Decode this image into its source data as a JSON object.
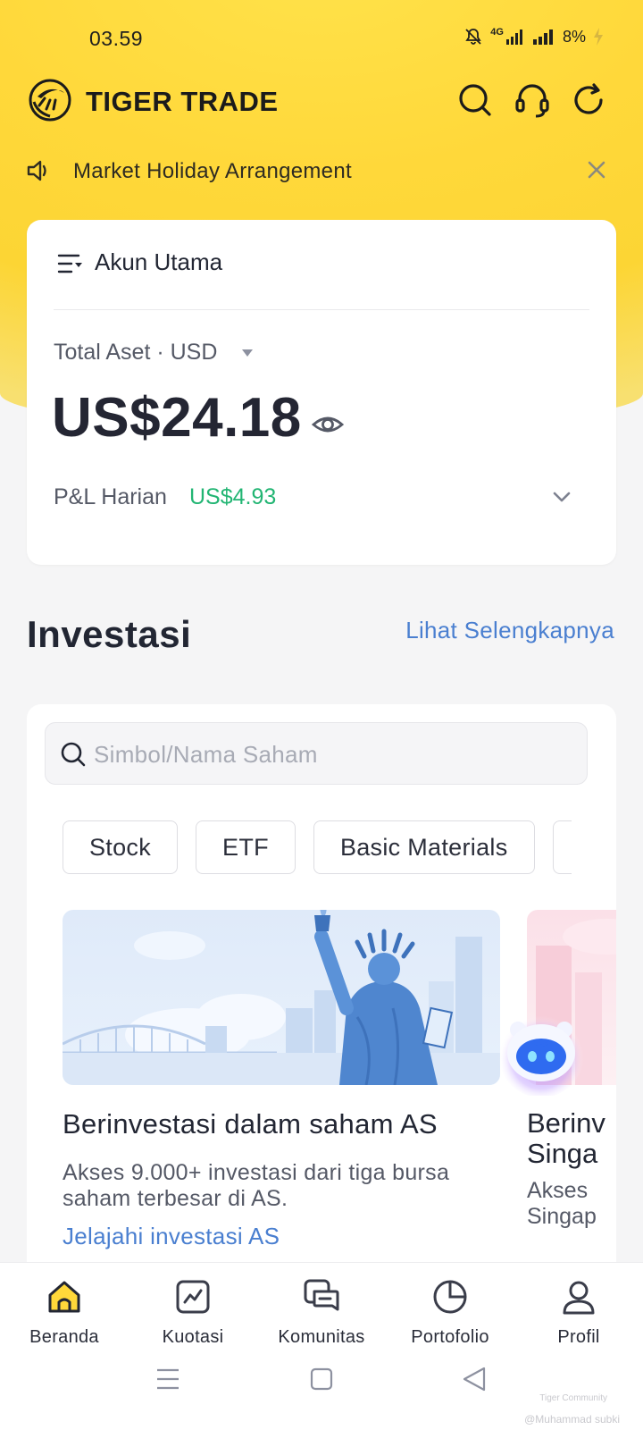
{
  "status_bar": {
    "time": "03.59",
    "network": "4G",
    "battery": "8%"
  },
  "header": {
    "brand": "TIGER TRADE"
  },
  "notice": {
    "text": "Market Holiday Arrangement"
  },
  "account": {
    "name": "Akun Utama",
    "total_label": "Total Aset · USD",
    "total_value": "US$24.18",
    "pnl_label": "P&L Harian",
    "pnl_value": "US$4.93",
    "pnl_color": "#22b573"
  },
  "investasi": {
    "title": "Investasi",
    "see_more": "Lihat Selengkapnya",
    "search_placeholder": "Simbol/Nama Saham",
    "chips": [
      "Stock",
      "ETF",
      "Basic Materials",
      ""
    ],
    "promos": [
      {
        "title": "Berinvestasi dalam saham AS",
        "desc": "Akses 9.000+ investasi dari tiga bursa saham terbesar di AS.",
        "link": "Jelajahi investasi AS"
      },
      {
        "title": "Berinv\nSinga",
        "desc": "Akses\nSingap"
      }
    ]
  },
  "bottom_nav": [
    {
      "label": "Beranda",
      "icon": "home-icon",
      "active": true
    },
    {
      "label": "Kuotasi",
      "icon": "chart-icon"
    },
    {
      "label": "Komunitas",
      "icon": "community-icon"
    },
    {
      "label": "Portofolio",
      "icon": "pie-icon"
    },
    {
      "label": "Profil",
      "icon": "profile-icon"
    }
  ],
  "watermark": {
    "line1": "Tiger Community",
    "line2": "@Muhammad subki"
  },
  "colors": {
    "brand_yellow": "#ffd83a",
    "link_blue": "#4a7fd0",
    "gain_green": "#22b573"
  }
}
